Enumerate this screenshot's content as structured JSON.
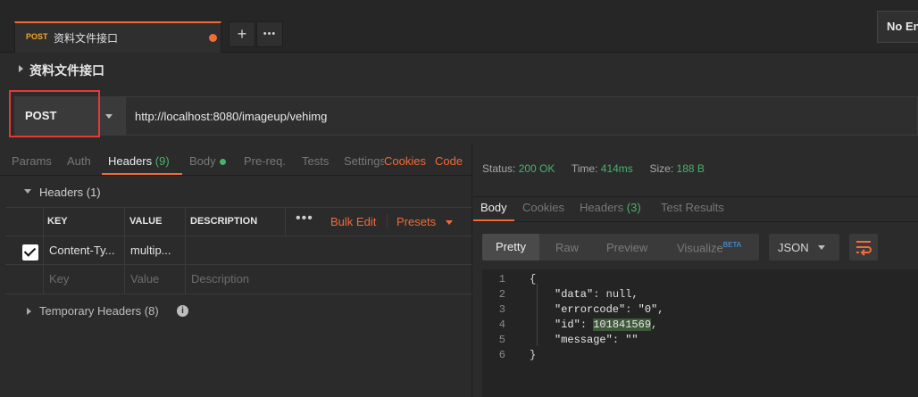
{
  "tabs": {
    "request_tab": {
      "method": "POST",
      "name": "资料文件接口"
    },
    "add_tab": "+",
    "more_tabs": "•••"
  },
  "environment": {
    "selected": "No Environment"
  },
  "request": {
    "title": "资料文件接口",
    "method": "POST",
    "url": "http://localhost:8080/imageup/vehimg"
  },
  "request_tabs": {
    "params": "Params",
    "auth": "Auth",
    "headers": "Headers",
    "headers_count": "(9)",
    "body": "Body",
    "prereq": "Pre-req.",
    "tests": "Tests",
    "settings": "Settings",
    "cookies": "Cookies",
    "code": "Code"
  },
  "headers_section": {
    "label": "Headers (1)",
    "columns": {
      "key": "KEY",
      "value": "VALUE",
      "description": "DESCRIPTION"
    },
    "more": "•••",
    "bulk_edit": "Bulk Edit",
    "presets": "Presets",
    "rows": [
      {
        "key": "Content-Ty...",
        "value": "multip...",
        "description": ""
      }
    ],
    "placeholders": {
      "key": "Key",
      "value": "Value",
      "description": "Description"
    }
  },
  "temp_headers": {
    "label": "Temporary Headers (8)",
    "info": "i"
  },
  "response": {
    "status_label": "Status:",
    "status_value": "200 OK",
    "time_label": "Time:",
    "time_value": "414ms",
    "size_label": "Size:",
    "size_value": "188 B",
    "tabs": {
      "body": "Body",
      "cookies": "Cookies",
      "headers": "Headers",
      "headers_count": "(3)",
      "test_results": "Test Results"
    },
    "view": {
      "pretty": "Pretty",
      "raw": "Raw",
      "preview": "Preview",
      "visualize": "Visualize",
      "beta": "BETA",
      "format": "JSON"
    },
    "lines": [
      "1",
      "2",
      "3",
      "4",
      "5",
      "6"
    ],
    "json": {
      "open": "{",
      "data_key": "\"data\"",
      "data_val": "null",
      "errorcode_key": "\"errorcode\"",
      "errorcode_val": "\"0\"",
      "id_key": "\"id\"",
      "id_val": "101841569",
      "message_key": "\"message\"",
      "message_val": "\"\"",
      "close": "}"
    }
  },
  "colors": {
    "accent": "#f26b3a",
    "success": "#47b36a",
    "highlight_box": "#e53935"
  }
}
